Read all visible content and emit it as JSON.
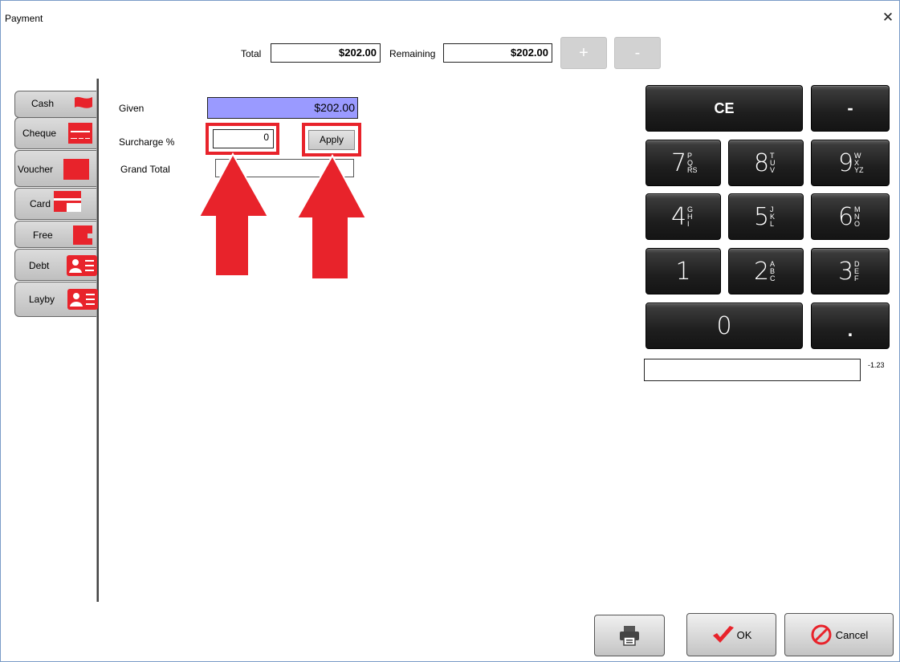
{
  "window": {
    "title": "Payment",
    "close_symbol": "✕"
  },
  "header": {
    "total_label": "Total",
    "total_value": "$202.00",
    "remaining_label": "Remaining",
    "remaining_value": "$202.00",
    "plus_label": "+",
    "minus_label": "-"
  },
  "tabs": [
    {
      "label": "Cash",
      "icon": "cash-icon"
    },
    {
      "label": "Cheque",
      "icon": "cheque-icon"
    },
    {
      "label": "Voucher",
      "icon": "voucher-icon"
    },
    {
      "label": "Card",
      "icon": "card-icon"
    },
    {
      "label": "Free",
      "icon": "free-icon"
    },
    {
      "label": "Debt",
      "icon": "contact-card-icon"
    },
    {
      "label": "Layby",
      "icon": "contact-card-icon"
    }
  ],
  "form": {
    "given_label": "Given",
    "given_value": "$202.00",
    "surcharge_label": "Surcharge %",
    "surcharge_value": "0",
    "apply_label": "Apply",
    "grand_total_label": "Grand Total",
    "grand_total_value": ""
  },
  "keypad": {
    "ce": "CE",
    "minus": "-",
    "dot": ".",
    "keys": [
      {
        "digit": "7",
        "letters": "PQRS"
      },
      {
        "digit": "8",
        "letters": "TUV"
      },
      {
        "digit": "9",
        "letters": "WXYZ"
      },
      {
        "digit": "4",
        "letters": "GHI"
      },
      {
        "digit": "5",
        "letters": "JKL"
      },
      {
        "digit": "6",
        "letters": "MNO"
      },
      {
        "digit": "1",
        "letters": ""
      },
      {
        "digit": "2",
        "letters": "ABC"
      },
      {
        "digit": "3",
        "letters": "DEF"
      },
      {
        "digit": "0",
        "letters": ""
      }
    ],
    "display_value": "",
    "format_hint": "-1.23"
  },
  "footer": {
    "print_icon": "printer-icon",
    "ok_label": "OK",
    "cancel_label": "Cancel"
  },
  "colors": {
    "accent_red": "#e8232b",
    "given_bg": "#9a9aff",
    "keypad_bg": "#1e1e1e"
  }
}
